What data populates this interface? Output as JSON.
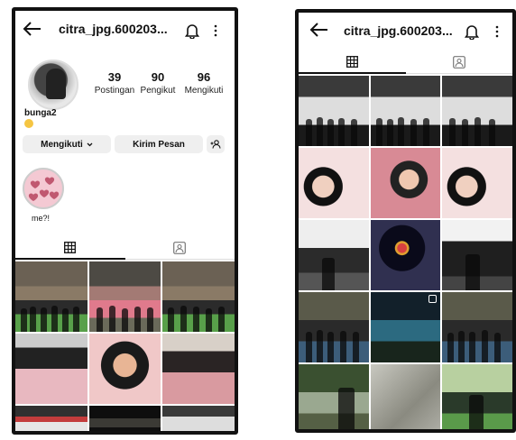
{
  "left_phone": {
    "username": "citra_jpg.600203...",
    "stats": [
      {
        "number": "39",
        "label": "Postingan"
      },
      {
        "number": "90",
        "label": "Pengikut"
      },
      {
        "number": "96",
        "label": "Mengikuti"
      }
    ],
    "bio_name": "bunga2",
    "buttons": {
      "following": "Mengikuti",
      "message": "Kirim Pesan"
    },
    "highlight_label": "me?!",
    "tabs": [
      "grid-icon",
      "tagged-icon"
    ]
  },
  "right_phone": {
    "username": "citra_jpg.600203...",
    "tabs": [
      "grid-icon",
      "tagged-icon"
    ]
  },
  "icons": {
    "back": "arrow-left-icon",
    "notifications": "bell-icon",
    "menu": "more-vertical-icon",
    "add_person": "add-person-icon",
    "chevron": "chevron-down-icon"
  }
}
